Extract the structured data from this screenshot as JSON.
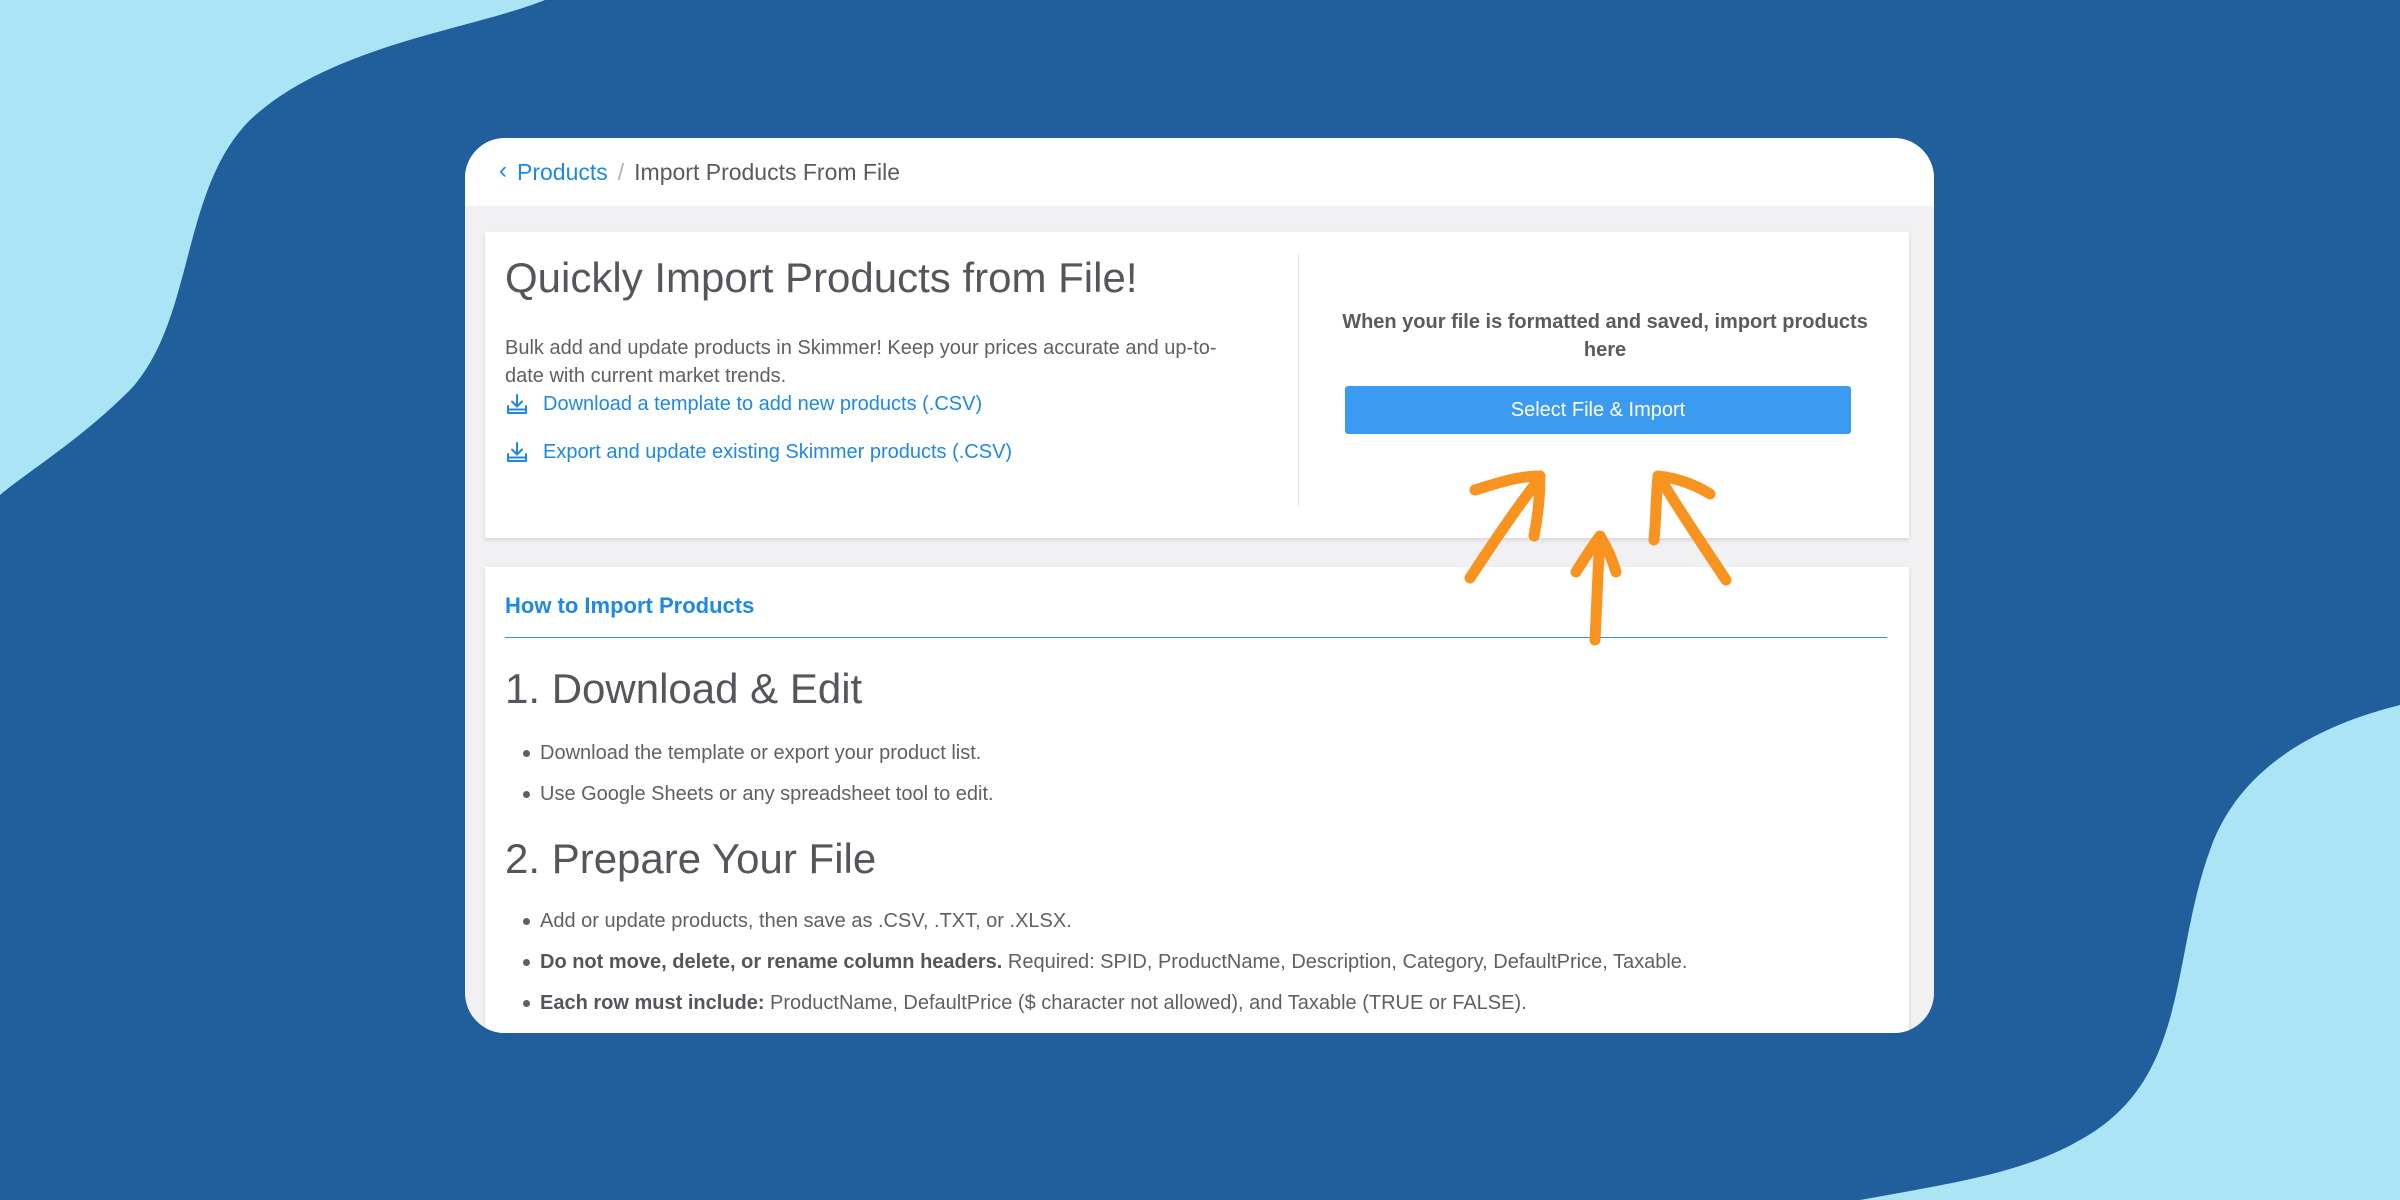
{
  "colors": {
    "background": "#215e9c",
    "background_accent": "#abe4f5",
    "link": "#1e88e5",
    "button": "#3a9bf0",
    "annotation_arrows": "#f7931e"
  },
  "breadcrumb": {
    "back_icon": "chevron-left-icon",
    "parent": "Products",
    "separator": "/",
    "current": "Import Products From File"
  },
  "import_card": {
    "title": "Quickly Import Products from File!",
    "description": "Bulk add and update products in Skimmer! Keep your prices accurate and up-to-date with current market trends.",
    "links": [
      {
        "icon": "download-icon",
        "label": "Download a template to add new products (.CSV)"
      },
      {
        "icon": "download-icon",
        "label": "Export and update existing Skimmer products (.CSV)"
      }
    ],
    "prompt": "When your file is formatted and saved, import products here",
    "button_label": "Select File & Import"
  },
  "howto": {
    "heading": "How to Import Products",
    "steps": [
      {
        "title": "1. Download & Edit",
        "items": [
          {
            "bold": "",
            "text": "Download the template or export your product list."
          },
          {
            "bold": "",
            "text": "Use Google Sheets or any spreadsheet tool to edit."
          }
        ]
      },
      {
        "title": "2. Prepare Your File",
        "items": [
          {
            "bold": "",
            "text": "Add or update products, then save as .CSV, .TXT, or .XLSX."
          },
          {
            "bold": "Do not move, delete, or rename column headers.",
            "text": " Required: SPID, ProductName, Description, Category, DefaultPrice, Taxable."
          },
          {
            "bold": "Each row must include:",
            "text": " ProductName, DefaultPrice ($ character not allowed), and Taxable (TRUE or FALSE)."
          }
        ]
      }
    ]
  }
}
